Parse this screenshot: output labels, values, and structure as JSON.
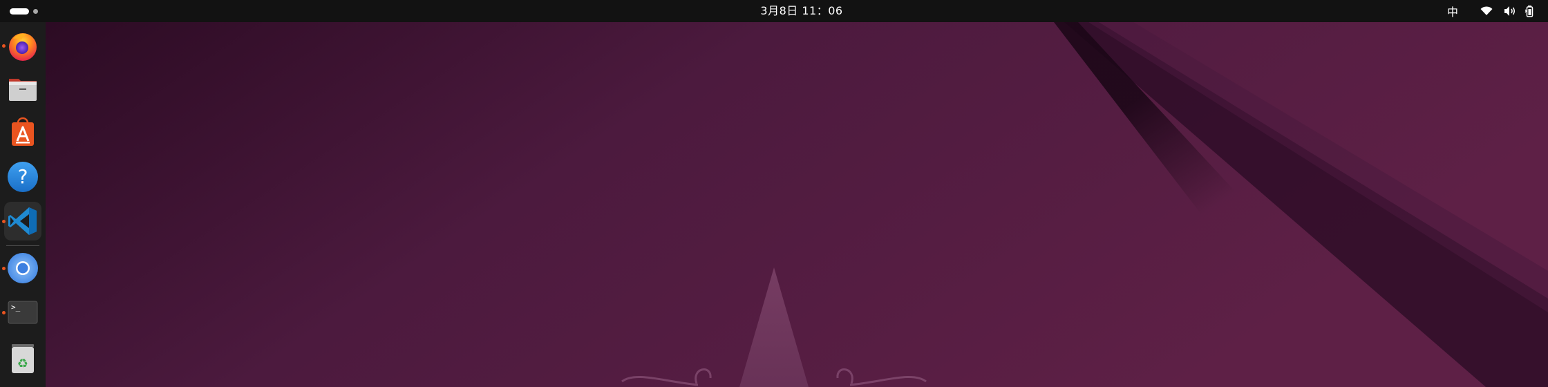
{
  "topbar": {
    "clock": "3月8日 11：06",
    "input_method": "中",
    "tray_icons": [
      "wifi-icon",
      "volume-icon",
      "battery-icon"
    ]
  },
  "dock": {
    "items": [
      {
        "name": "firefox",
        "icon": "firefox-icon",
        "running": true
      },
      {
        "name": "files",
        "icon": "folder-icon",
        "running": false
      },
      {
        "name": "app-center",
        "icon": "app-center-icon",
        "running": false
      },
      {
        "name": "help",
        "icon": "help-icon",
        "running": false
      },
      {
        "name": "vscode",
        "icon": "vscode-icon",
        "running": true,
        "active": true
      },
      {
        "name": "chromium",
        "icon": "chromium-icon",
        "running": true
      },
      {
        "name": "terminal",
        "icon": "terminal-icon",
        "running": true
      },
      {
        "name": "trash",
        "icon": "trash-icon",
        "running": false
      }
    ],
    "terminal_prompt": ">_",
    "help_glyph": "?",
    "trash_glyph": "♻"
  },
  "colors": {
    "topbar": "#121212",
    "dock": "#1c1c1c",
    "wallpaper_dark": "#2a0a22",
    "wallpaper_mid": "#4c1a3e",
    "wallpaper_light": "#5e2046",
    "accent": "#e95420"
  }
}
